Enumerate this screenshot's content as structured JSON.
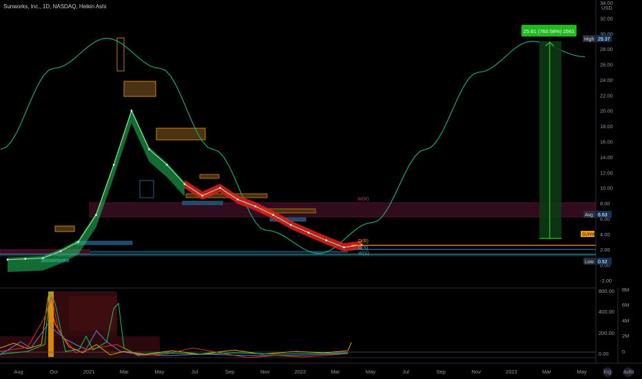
{
  "header": {
    "title": "Sunworks, Inc., 1D, NASDAQ, Heikin Ashi"
  },
  "price_axis": {
    "ticks": [
      "34.00",
      "32.00",
      "30.00",
      "28.00",
      "26.00",
      "24.00",
      "22.00",
      "20.00",
      "18.00",
      "16.00",
      "14.00",
      "12.00",
      "10.00",
      "8.00",
      "6.00",
      "4.00",
      "2.00",
      "0.00",
      "-2.00"
    ],
    "currency": "USD"
  },
  "lower_axis": {
    "left_ticks": [
      "800.00",
      "400.00",
      "200.00",
      "0.00"
    ],
    "right_ticks": [
      "8M",
      "6M",
      "4M",
      "2M",
      "0"
    ]
  },
  "time_axis": {
    "labels": [
      "Aug",
      "Oct",
      "2021",
      "Mar",
      "May",
      "Jul",
      "Sep",
      "Nov",
      "2022",
      "Mar",
      "May",
      "Jul",
      "Sep",
      "Nov",
      "2023",
      "Mar",
      "May"
    ]
  },
  "badges": {
    "high_label": "High",
    "high_value": "29.37",
    "avg_label": "Avg",
    "avg_value": "6.63",
    "low_label": "Low",
    "low_value": "0.52",
    "ticker": "SUNW"
  },
  "measure": {
    "label": "25.61 (760.58%) 2561"
  },
  "level_labels": [
    "W(R)",
    "D(R)",
    "D(S)",
    "W(S)"
  ],
  "buttons": {
    "log": "log",
    "auto": "auto"
  },
  "colors": {
    "background": "#000000",
    "sine": "#1fa97a",
    "ribbon_up": "#22c55e",
    "ribbon_down": "#e02020",
    "orange": "#f59e0b",
    "measure": "#22dd22",
    "avg_badge": "#2a2e39"
  },
  "chart_data": {
    "type": "line",
    "title": "Sunworks, Inc., 1D, NASDAQ, Heikin Ashi",
    "xlabel": "",
    "ylabel": "",
    "ylim": [
      -2,
      34
    ],
    "grid": false,
    "price_series": {
      "name": "SUNW",
      "x": [
        "2020-07",
        "2020-08",
        "2020-09",
        "2020-10",
        "2020-11",
        "2020-12",
        "2021-01",
        "2021-02",
        "2021-03",
        "2021-04",
        "2021-05",
        "2021-06",
        "2021-07",
        "2021-08",
        "2021-09",
        "2021-10",
        "2021-11",
        "2021-12",
        "2022-01",
        "2022-02",
        "2022-03"
      ],
      "y": [
        0.7,
        0.8,
        0.9,
        1.8,
        3.0,
        6.5,
        13.0,
        20.0,
        15.0,
        13.0,
        10.5,
        9.0,
        10.0,
        8.5,
        7.6,
        6.5,
        5.2,
        4.2,
        3.2,
        2.3,
        2.6
      ]
    },
    "sine_cycle": {
      "x": [
        "2020-07",
        "2020-10",
        "2021-01",
        "2021-04",
        "2021-07",
        "2021-10",
        "2022-01",
        "2022-04",
        "2022-07",
        "2022-10",
        "2023-01",
        "2023-04"
      ],
      "y": [
        15.0,
        25.5,
        29.4,
        25.5,
        15.0,
        4.5,
        1.5,
        5.5,
        15.0,
        25.0,
        29.0,
        27.0
      ]
    },
    "levels": {
      "high": 29.37,
      "avg": 6.63,
      "low": 0.52,
      "last": 2.6
    },
    "measure_change": {
      "absolute": 25.61,
      "percent": 760.58,
      "ticks": 2561,
      "from": 3.0,
      "to": 29.37
    }
  }
}
